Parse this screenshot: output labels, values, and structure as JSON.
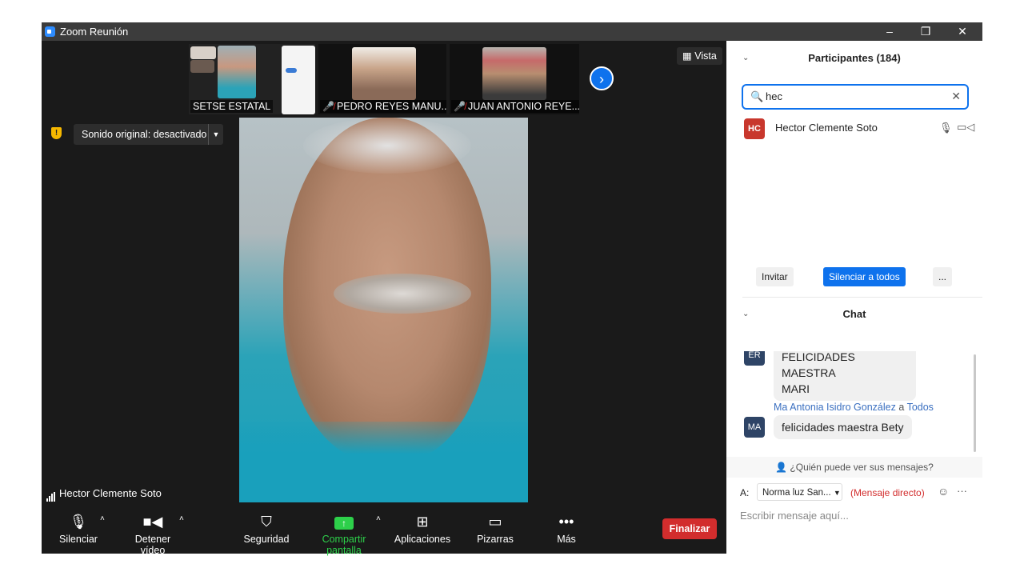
{
  "window": {
    "title": "Zoom Reunión",
    "controls": [
      "–",
      "❐",
      "✕"
    ]
  },
  "strip": {
    "tiles": [
      {
        "label": "SETSE ESTATAL",
        "muted": false
      },
      {
        "label": "PEDRO REYES MANU...",
        "muted": true
      },
      {
        "label": "JUAN ANTONIO REYE...",
        "muted": true
      }
    ],
    "next_icon": "›"
  },
  "view_label": "Vista",
  "original_sound": "Sonido original: desactivado",
  "speaker_name": "Hector Clemente Soto",
  "toolbar": {
    "mute": "Silenciar",
    "stop_video": "Detener vídeo",
    "security": "Seguridad",
    "share": "Compartir pantalla",
    "apps": "Aplicaciones",
    "whiteboards": "Pizarras",
    "more": "Más",
    "end": "Finalizar"
  },
  "participants": {
    "header": "Participantes (184)",
    "search_value": "hec",
    "results": [
      {
        "initials": "HC",
        "name": "Hector Clemente Soto",
        "avatar_color": "#c8372d"
      }
    ],
    "invite": "Invitar",
    "mute_all": "Silenciar a todos",
    "more": "..."
  },
  "chat": {
    "header": "Chat",
    "messages": [
      {
        "initials": "ER",
        "sender": "",
        "lines": [
          "FELICIDADES MAESTRA",
          "MARI"
        ]
      },
      {
        "initials": "MA",
        "sender": "Ma Antonia Isidro González",
        "to_word": "a",
        "recipient": "Todos",
        "lines": [
          "felicidades maestra Bety"
        ]
      }
    ],
    "who_can_see": "¿Quién puede ver sus mensajes?",
    "to_label": "A:",
    "to_value": "Norma luz San...",
    "direct": "(Mensaje directo)",
    "placeholder": "Escribir mensaje aquí..."
  }
}
